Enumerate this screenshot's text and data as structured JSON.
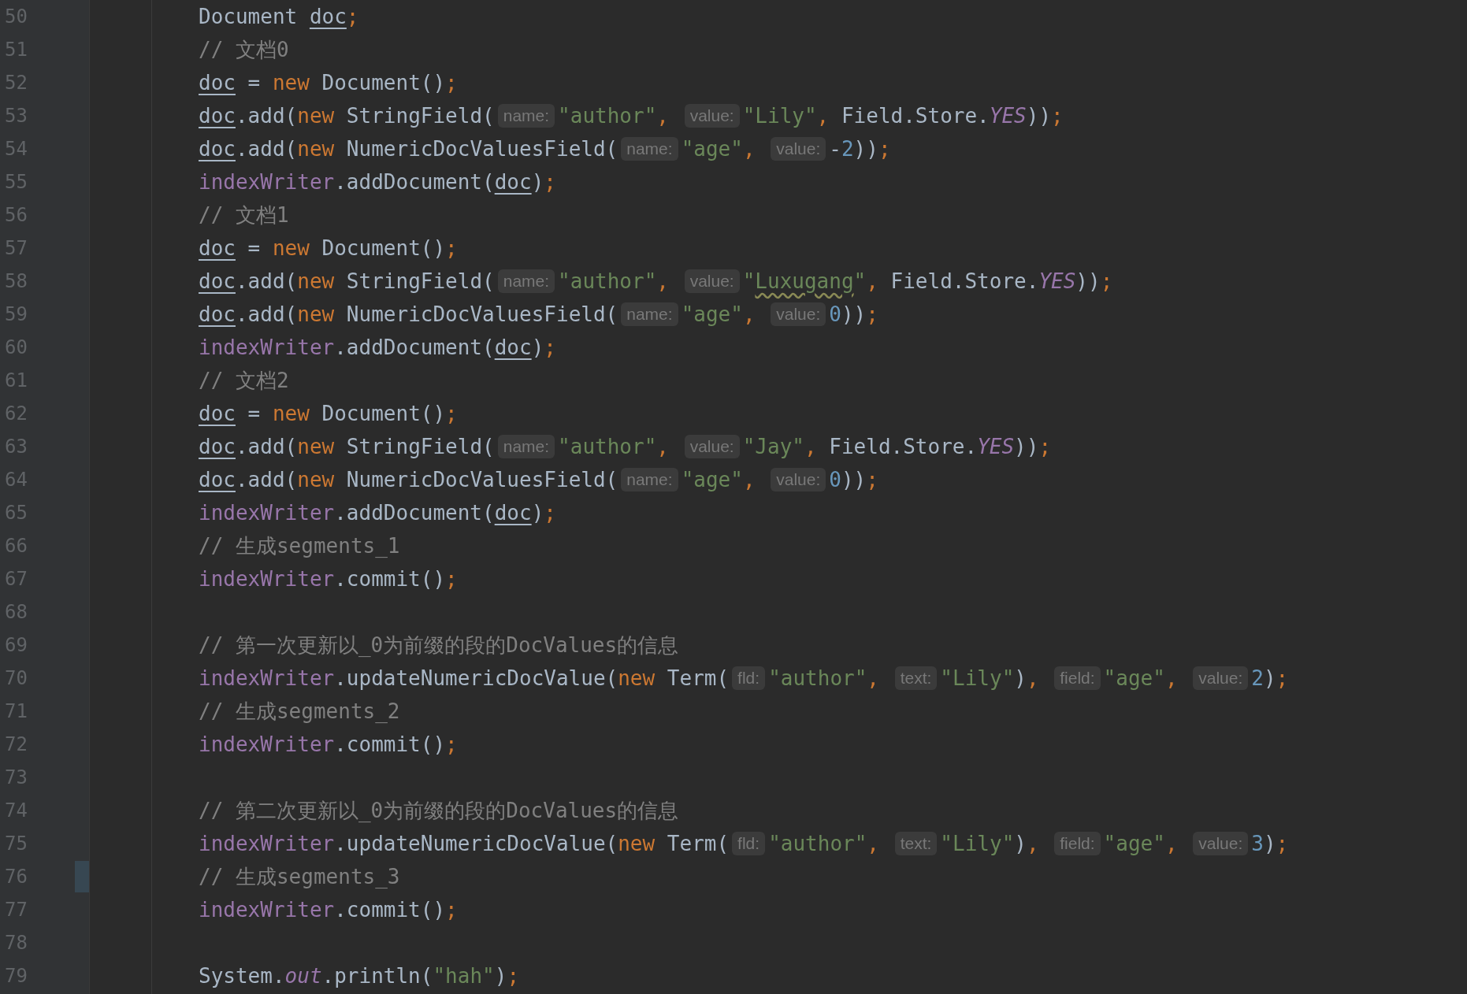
{
  "editor": {
    "lines": [
      {
        "number": "50",
        "tokens": [
          {
            "kind": "plain",
            "text": "Document "
          },
          {
            "kind": "var",
            "text": "doc"
          },
          {
            "kind": "keyword",
            "text": ";"
          }
        ]
      },
      {
        "number": "51",
        "tokens": [
          {
            "kind": "comment",
            "text": "// 文档0"
          }
        ]
      },
      {
        "number": "52",
        "tokens": [
          {
            "kind": "var",
            "text": "doc"
          },
          {
            "kind": "plain",
            "text": " = "
          },
          {
            "kind": "keyword",
            "text": "new"
          },
          {
            "kind": "plain",
            "text": " Document()"
          },
          {
            "kind": "keyword",
            "text": ";"
          }
        ]
      },
      {
        "number": "53",
        "tokens": [
          {
            "kind": "var",
            "text": "doc"
          },
          {
            "kind": "plain",
            "text": ".add("
          },
          {
            "kind": "keyword",
            "text": "new"
          },
          {
            "kind": "plain",
            "text": " StringField("
          },
          {
            "kind": "hint",
            "text": "name:"
          },
          {
            "kind": "string",
            "text": "\"author\""
          },
          {
            "kind": "keyword",
            "text": ", "
          },
          {
            "kind": "hint",
            "text": "value:"
          },
          {
            "kind": "string",
            "text": "\"Lily\""
          },
          {
            "kind": "keyword",
            "text": ", "
          },
          {
            "kind": "plain",
            "text": "Field.Store."
          },
          {
            "kind": "constant",
            "text": "YES"
          },
          {
            "kind": "plain",
            "text": "))"
          },
          {
            "kind": "keyword",
            "text": ";"
          }
        ]
      },
      {
        "number": "54",
        "tokens": [
          {
            "kind": "var",
            "text": "doc"
          },
          {
            "kind": "plain",
            "text": ".add("
          },
          {
            "kind": "keyword",
            "text": "new"
          },
          {
            "kind": "plain",
            "text": " NumericDocValuesField("
          },
          {
            "kind": "hint",
            "text": "name:"
          },
          {
            "kind": "string",
            "text": "\"age\""
          },
          {
            "kind": "keyword",
            "text": ", "
          },
          {
            "kind": "hint",
            "text": "value:"
          },
          {
            "kind": "plain",
            "text": "-"
          },
          {
            "kind": "number",
            "text": "2"
          },
          {
            "kind": "plain",
            "text": "))"
          },
          {
            "kind": "keyword",
            "text": ";"
          }
        ]
      },
      {
        "number": "55",
        "tokens": [
          {
            "kind": "field",
            "text": "indexWriter"
          },
          {
            "kind": "plain",
            "text": ".addDocument("
          },
          {
            "kind": "var",
            "text": "doc"
          },
          {
            "kind": "plain",
            "text": ")"
          },
          {
            "kind": "keyword",
            "text": ";"
          }
        ]
      },
      {
        "number": "56",
        "tokens": [
          {
            "kind": "comment",
            "text": "// 文档1"
          }
        ]
      },
      {
        "number": "57",
        "tokens": [
          {
            "kind": "var",
            "text": "doc"
          },
          {
            "kind": "plain",
            "text": " = "
          },
          {
            "kind": "keyword",
            "text": "new"
          },
          {
            "kind": "plain",
            "text": " Document()"
          },
          {
            "kind": "keyword",
            "text": ";"
          }
        ]
      },
      {
        "number": "58",
        "tokens": [
          {
            "kind": "var",
            "text": "doc"
          },
          {
            "kind": "plain",
            "text": ".add("
          },
          {
            "kind": "keyword",
            "text": "new"
          },
          {
            "kind": "plain",
            "text": " StringField("
          },
          {
            "kind": "hint",
            "text": "name:"
          },
          {
            "kind": "string",
            "text": "\"author\""
          },
          {
            "kind": "keyword",
            "text": ", "
          },
          {
            "kind": "hint",
            "text": "value:"
          },
          {
            "kind": "string",
            "text": "\""
          },
          {
            "kind": "typo",
            "text": "Luxugang"
          },
          {
            "kind": "string",
            "text": "\""
          },
          {
            "kind": "keyword",
            "text": ", "
          },
          {
            "kind": "plain",
            "text": "Field.Store."
          },
          {
            "kind": "constant",
            "text": "YES"
          },
          {
            "kind": "plain",
            "text": "))"
          },
          {
            "kind": "keyword",
            "text": ";"
          }
        ]
      },
      {
        "number": "59",
        "tokens": [
          {
            "kind": "var",
            "text": "doc"
          },
          {
            "kind": "plain",
            "text": ".add("
          },
          {
            "kind": "keyword",
            "text": "new"
          },
          {
            "kind": "plain",
            "text": " NumericDocValuesField("
          },
          {
            "kind": "hint",
            "text": "name:"
          },
          {
            "kind": "string",
            "text": "\"age\""
          },
          {
            "kind": "keyword",
            "text": ", "
          },
          {
            "kind": "hint",
            "text": "value:"
          },
          {
            "kind": "number",
            "text": "0"
          },
          {
            "kind": "plain",
            "text": "))"
          },
          {
            "kind": "keyword",
            "text": ";"
          }
        ]
      },
      {
        "number": "60",
        "tokens": [
          {
            "kind": "field",
            "text": "indexWriter"
          },
          {
            "kind": "plain",
            "text": ".addDocument("
          },
          {
            "kind": "var",
            "text": "doc"
          },
          {
            "kind": "plain",
            "text": ")"
          },
          {
            "kind": "keyword",
            "text": ";"
          }
        ]
      },
      {
        "number": "61",
        "tokens": [
          {
            "kind": "comment",
            "text": "// 文档2"
          }
        ]
      },
      {
        "number": "62",
        "tokens": [
          {
            "kind": "var",
            "text": "doc"
          },
          {
            "kind": "plain",
            "text": " = "
          },
          {
            "kind": "keyword",
            "text": "new"
          },
          {
            "kind": "plain",
            "text": " Document()"
          },
          {
            "kind": "keyword",
            "text": ";"
          }
        ]
      },
      {
        "number": "63",
        "tokens": [
          {
            "kind": "var",
            "text": "doc"
          },
          {
            "kind": "plain",
            "text": ".add("
          },
          {
            "kind": "keyword",
            "text": "new"
          },
          {
            "kind": "plain",
            "text": " StringField("
          },
          {
            "kind": "hint",
            "text": "name:"
          },
          {
            "kind": "string",
            "text": "\"author\""
          },
          {
            "kind": "keyword",
            "text": ", "
          },
          {
            "kind": "hint",
            "text": "value:"
          },
          {
            "kind": "string",
            "text": "\"Jay\""
          },
          {
            "kind": "keyword",
            "text": ", "
          },
          {
            "kind": "plain",
            "text": "Field.Store."
          },
          {
            "kind": "constant",
            "text": "YES"
          },
          {
            "kind": "plain",
            "text": "))"
          },
          {
            "kind": "keyword",
            "text": ";"
          }
        ]
      },
      {
        "number": "64",
        "tokens": [
          {
            "kind": "var",
            "text": "doc"
          },
          {
            "kind": "plain",
            "text": ".add("
          },
          {
            "kind": "keyword",
            "text": "new"
          },
          {
            "kind": "plain",
            "text": " NumericDocValuesField("
          },
          {
            "kind": "hint",
            "text": "name:"
          },
          {
            "kind": "string",
            "text": "\"age\""
          },
          {
            "kind": "keyword",
            "text": ", "
          },
          {
            "kind": "hint",
            "text": "value:"
          },
          {
            "kind": "number",
            "text": "0"
          },
          {
            "kind": "plain",
            "text": "))"
          },
          {
            "kind": "keyword",
            "text": ";"
          }
        ]
      },
      {
        "number": "65",
        "tokens": [
          {
            "kind": "field",
            "text": "indexWriter"
          },
          {
            "kind": "plain",
            "text": ".addDocument("
          },
          {
            "kind": "var",
            "text": "doc"
          },
          {
            "kind": "plain",
            "text": ")"
          },
          {
            "kind": "keyword",
            "text": ";"
          }
        ]
      },
      {
        "number": "66",
        "tokens": [
          {
            "kind": "comment",
            "text": "// 生成segments_1"
          }
        ]
      },
      {
        "number": "67",
        "tokens": [
          {
            "kind": "field",
            "text": "indexWriter"
          },
          {
            "kind": "plain",
            "text": ".commit()"
          },
          {
            "kind": "keyword",
            "text": ";"
          }
        ]
      },
      {
        "number": "68"
      },
      {
        "number": "69",
        "tokens": [
          {
            "kind": "comment",
            "text": "// 第一次更新以_0为前缀的段的DocValues的信息"
          }
        ]
      },
      {
        "number": "70",
        "tokens": [
          {
            "kind": "field",
            "text": "indexWriter"
          },
          {
            "kind": "plain",
            "text": ".updateNumericDocValue("
          },
          {
            "kind": "keyword",
            "text": "new"
          },
          {
            "kind": "plain",
            "text": " Term("
          },
          {
            "kind": "hint",
            "text": "fld:"
          },
          {
            "kind": "string",
            "text": "\"author\""
          },
          {
            "kind": "keyword",
            "text": ", "
          },
          {
            "kind": "hint",
            "text": "text:"
          },
          {
            "kind": "string",
            "text": "\"Lily\""
          },
          {
            "kind": "plain",
            "text": ")"
          },
          {
            "kind": "keyword",
            "text": ", "
          },
          {
            "kind": "hint",
            "text": "field:"
          },
          {
            "kind": "string",
            "text": "\"age\""
          },
          {
            "kind": "keyword",
            "text": ", "
          },
          {
            "kind": "hint",
            "text": "value:"
          },
          {
            "kind": "number",
            "text": "2"
          },
          {
            "kind": "plain",
            "text": ")"
          },
          {
            "kind": "keyword",
            "text": ";"
          }
        ]
      },
      {
        "number": "71",
        "tokens": [
          {
            "kind": "comment",
            "text": "// 生成segments_2"
          }
        ]
      },
      {
        "number": "72",
        "tokens": [
          {
            "kind": "field",
            "text": "indexWriter"
          },
          {
            "kind": "plain",
            "text": ".commit()"
          },
          {
            "kind": "keyword",
            "text": ";"
          }
        ]
      },
      {
        "number": "73"
      },
      {
        "number": "74",
        "tokens": [
          {
            "kind": "comment",
            "text": "// 第二次更新以_0为前缀的段的DocValues的信息"
          }
        ]
      },
      {
        "number": "75",
        "tokens": [
          {
            "kind": "field",
            "text": "indexWriter"
          },
          {
            "kind": "plain",
            "text": ".updateNumericDocValue("
          },
          {
            "kind": "keyword",
            "text": "new"
          },
          {
            "kind": "plain",
            "text": " Term("
          },
          {
            "kind": "hint",
            "text": "fld:"
          },
          {
            "kind": "string",
            "text": "\"author\""
          },
          {
            "kind": "keyword",
            "text": ", "
          },
          {
            "kind": "hint",
            "text": "text:"
          },
          {
            "kind": "string",
            "text": "\"Lily\""
          },
          {
            "kind": "plain",
            "text": ")"
          },
          {
            "kind": "keyword",
            "text": ", "
          },
          {
            "kind": "hint",
            "text": "field:"
          },
          {
            "kind": "string",
            "text": "\"age\""
          },
          {
            "kind": "keyword",
            "text": ", "
          },
          {
            "kind": "hint",
            "text": "value:"
          },
          {
            "kind": "number",
            "text": "3"
          },
          {
            "kind": "plain",
            "text": ")"
          },
          {
            "kind": "keyword",
            "text": ";"
          }
        ]
      },
      {
        "number": "76",
        "changed": true,
        "tokens": [
          {
            "kind": "comment",
            "text": "// 生成segments_3"
          }
        ]
      },
      {
        "number": "77",
        "tokens": [
          {
            "kind": "field",
            "text": "indexWriter"
          },
          {
            "kind": "plain",
            "text": ".commit()"
          },
          {
            "kind": "keyword",
            "text": ";"
          }
        ]
      },
      {
        "number": "78"
      },
      {
        "number": "79",
        "tokens": [
          {
            "kind": "plain",
            "text": "System."
          },
          {
            "kind": "constant",
            "text": "out"
          },
          {
            "kind": "plain",
            "text": ".println("
          },
          {
            "kind": "string",
            "text": "\"hah\""
          },
          {
            "kind": "plain",
            "text": ")"
          },
          {
            "kind": "keyword",
            "text": ";"
          }
        ]
      }
    ]
  }
}
